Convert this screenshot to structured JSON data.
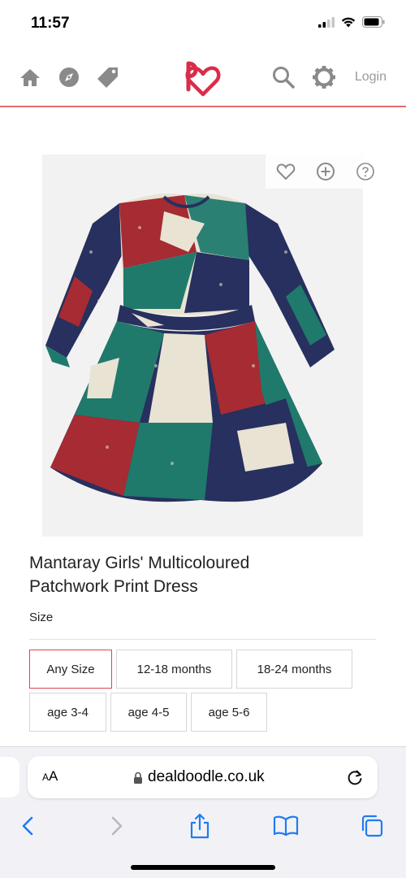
{
  "status": {
    "time": "11:57"
  },
  "header": {
    "login_label": "Login"
  },
  "product": {
    "title_line1": "Mantaray Girls' Multicoloured",
    "title_line2": "Patchwork Print Dress",
    "size_label": "Size",
    "sizes": [
      "Any Size",
      "12-18 months",
      "18-24 months",
      "age 3-4",
      "age 4-5",
      "age 5-6"
    ],
    "selected_size": "Any Size"
  },
  "browser": {
    "aa_label_small": "A",
    "aa_label": "A",
    "url": "dealdoodle.co.uk"
  },
  "colors": {
    "brand": "#d92d4a",
    "header_rule": "#e26f6f",
    "selected_border": "#d9484f",
    "ios_blue": "#1f7cf2"
  },
  "icons": {
    "header": [
      "home-icon",
      "compass-icon",
      "tag-icon",
      "search-icon",
      "settings-icon"
    ],
    "image_actions": [
      "heart-icon",
      "add-icon",
      "help-icon"
    ],
    "toolbar": [
      "back-icon",
      "forward-icon",
      "share-icon",
      "bookmarks-icon",
      "tabs-icon"
    ]
  }
}
